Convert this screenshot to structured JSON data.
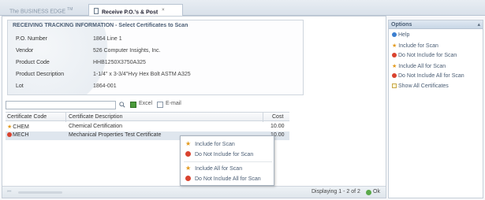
{
  "tabs": [
    {
      "label": "The BUSINESS EDGE",
      "tm": "TM"
    },
    {
      "label": "Receive P.O.'s & Post"
    }
  ],
  "info": {
    "title": "RECEIVING TRACKING INFORMATION - Select Certificates to Scan",
    "rows": [
      {
        "label": "P.O. Number",
        "value": "1864 Line 1"
      },
      {
        "label": "Vendor",
        "value": "526 Computer Insights, Inc."
      },
      {
        "label": "Product Code",
        "value": "HHB1250X3750A325"
      },
      {
        "label": "Product Description",
        "value": "1-1/4\" x 3-3/4\"Hvy Hex Bolt ASTM A325"
      },
      {
        "label": "Lot",
        "value": "1864-001"
      }
    ]
  },
  "toolbar": {
    "search_value": "",
    "excel_label": "Excel",
    "email_label": "E-mail",
    "excel_checked": true,
    "email_checked": false
  },
  "grid": {
    "headers": [
      "Certificate Code",
      "Certificate Description",
      "Cost"
    ],
    "rows": [
      {
        "code": "CHEM",
        "description": "Chemical Certification",
        "cost": "10.00",
        "status": "include"
      },
      {
        "code": "MECH",
        "description": "Mechanical Properties Test Certificate",
        "cost": "10.00",
        "status": "exclude"
      }
    ]
  },
  "context_menu": {
    "items": [
      {
        "label": "Include for Scan",
        "icon": "star-icon"
      },
      {
        "label": "Do Not Include for Scan",
        "icon": "no-icon"
      },
      {
        "label": "Include All for Scan",
        "icon": "star-icon"
      },
      {
        "label": "Do Not Include All for Scan",
        "icon": "no-icon"
      }
    ]
  },
  "status": {
    "displaying": "Displaying 1 - 2 of 2",
    "ok_label": "Ok"
  },
  "options": {
    "title": "Options",
    "items": [
      {
        "label": "Help",
        "icon": "help-icon"
      },
      {
        "label": "Include for Scan",
        "icon": "star-icon"
      },
      {
        "label": "Do Not Include for Scan",
        "icon": "no-icon"
      },
      {
        "label": "Include All for Scan",
        "icon": "star-icon"
      },
      {
        "label": "Do Not Include All for Scan",
        "icon": "no-icon"
      },
      {
        "label": "Show All Certificates",
        "icon": "certificates-icon"
      }
    ]
  },
  "colors": {
    "accent": "#4a5d74",
    "include": "#e39a1c",
    "exclude": "#d9432f",
    "ok": "#5aa94a"
  }
}
